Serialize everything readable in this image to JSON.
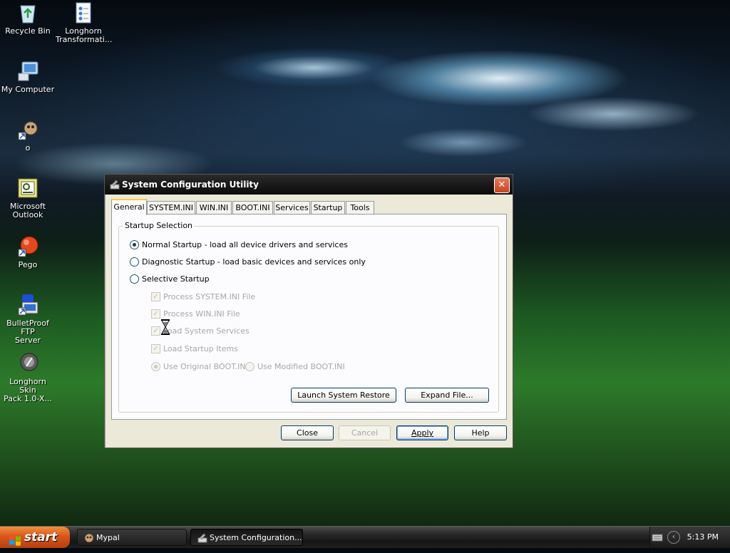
{
  "desktop": {
    "icons": [
      {
        "label_line1": "Recycle Bin",
        "label_line2": "",
        "icon": "recycle-bin-icon"
      },
      {
        "label_line1": "Longhorn",
        "label_line2": "Transformati...",
        "icon": "document-icon"
      },
      {
        "label_line1": "My Computer",
        "label_line2": "",
        "icon": "computer-icon"
      },
      {
        "label_line1": "o",
        "label_line2": "",
        "icon": "shortcut-icon"
      },
      {
        "label_line1": "Microsoft",
        "label_line2": "Outlook",
        "icon": "outlook-icon"
      },
      {
        "label_line1": "Pego",
        "label_line2": "",
        "icon": "red-orb-icon"
      },
      {
        "label_line1": "BulletProof FTP",
        "label_line2": "Server",
        "icon": "ftp-icon"
      },
      {
        "label_line1": "Longhorn Skin",
        "label_line2": "Pack 1.0-X...",
        "icon": "skin-pack-icon"
      }
    ]
  },
  "window": {
    "title": "System Configuration Utility",
    "tabs": [
      "General",
      "SYSTEM.INI",
      "WIN.INI",
      "BOOT.INI",
      "Services",
      "Startup",
      "Tools"
    ],
    "active_tab": "General",
    "group_label": "Startup Selection",
    "options": {
      "normal": "Normal Startup - load all device drivers and services",
      "diagnostic": "Diagnostic Startup - load basic devices and services only",
      "selective": "Selective Startup"
    },
    "selected_option": "normal",
    "checkboxes": {
      "system_ini": "Process SYSTEM.INI File",
      "win_ini": "Process WIN.INI File",
      "system_services": "Load System Services",
      "startup_items": "Load Startup Items"
    },
    "boot_radios": {
      "original": "Use Original BOOT.INI",
      "modified": "Use Modified BOOT.INI"
    },
    "buttons": {
      "restore": "Launch System Restore",
      "expand": "Expand File...",
      "close": "Close",
      "cancel": "Cancel",
      "apply": "Apply",
      "help": "Help"
    }
  },
  "taskbar": {
    "start_label": "start",
    "tasks": [
      "Mypal",
      "System Configuration..."
    ],
    "clock": "5:13 PM"
  },
  "colors": {
    "taskbar": "#1f1f1f",
    "start_button": "#d9561a",
    "title_bar": "#1a1a1a",
    "window_body": "#ece9d8",
    "close_button": "#c9421e"
  }
}
